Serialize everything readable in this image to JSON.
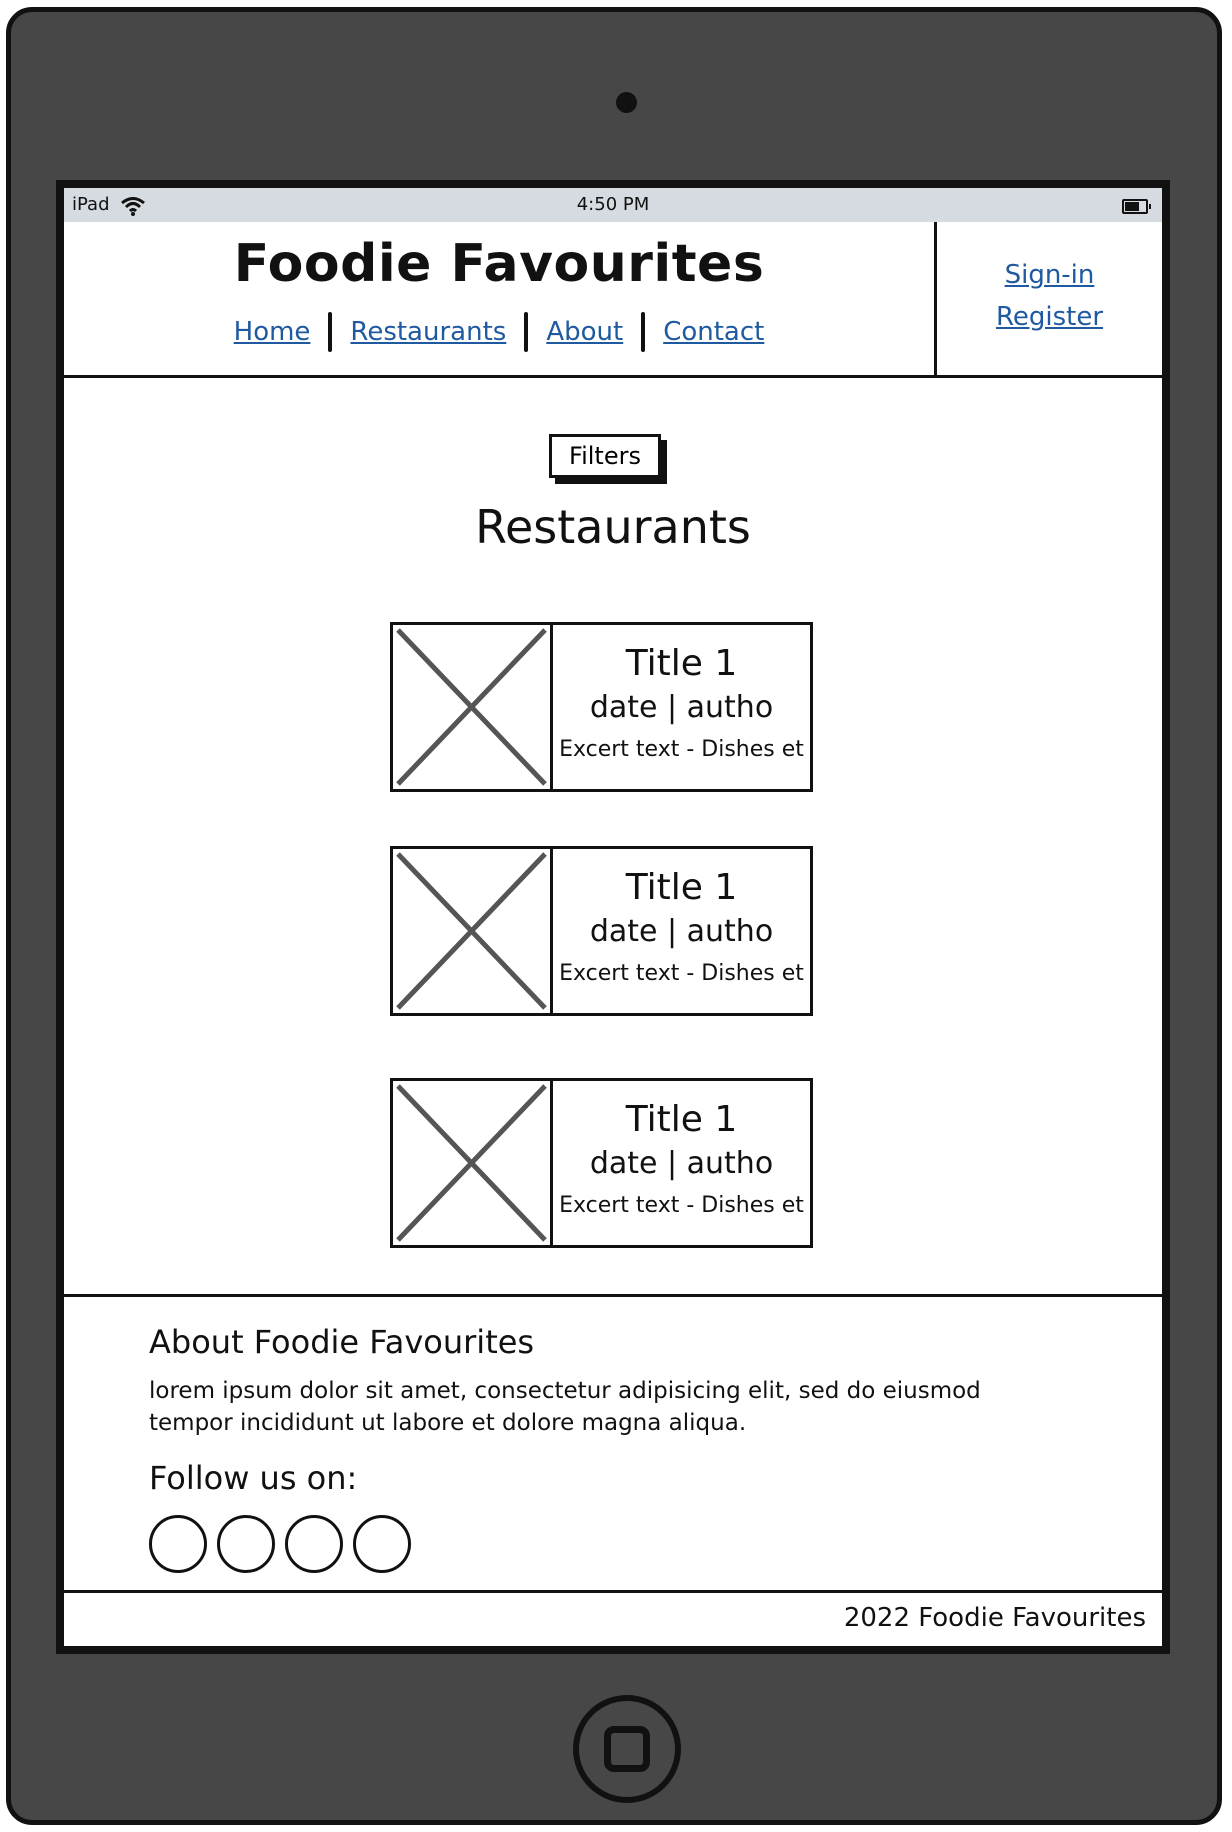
{
  "status_bar": {
    "device": "iPad",
    "time": "4:50 PM"
  },
  "header": {
    "title": "Foodie Favourites",
    "nav": [
      {
        "label": "Home"
      },
      {
        "label": "Restaurants"
      },
      {
        "label": "About"
      },
      {
        "label": "Contact"
      }
    ],
    "sign_in": "Sign-in",
    "register": "Register"
  },
  "main": {
    "filters_label": "Filters",
    "section_title": "Restaurants",
    "cards": [
      {
        "title": "Title 1",
        "meta": "date | autho",
        "excerpt": "Excert text - Dishes et"
      },
      {
        "title": "Title 1",
        "meta": "date | autho",
        "excerpt": "Excert text - Dishes et"
      },
      {
        "title": "Title 1",
        "meta": "date | autho",
        "excerpt": "Excert text - Dishes et"
      }
    ]
  },
  "footer": {
    "about_title": "About Foodie Favourites",
    "about_text": "lorem ipsum dolor sit amet, consectetur adipisicing elit, sed do eiusmod tempor incididunt ut labore et dolore magna aliqua.",
    "follow_label": "Follow us on:",
    "copyright": "2022 Foodie Favourites"
  },
  "colors": {
    "link": "#1f5aa0",
    "status_bar": "#d5dbe0",
    "device": "#474747"
  }
}
